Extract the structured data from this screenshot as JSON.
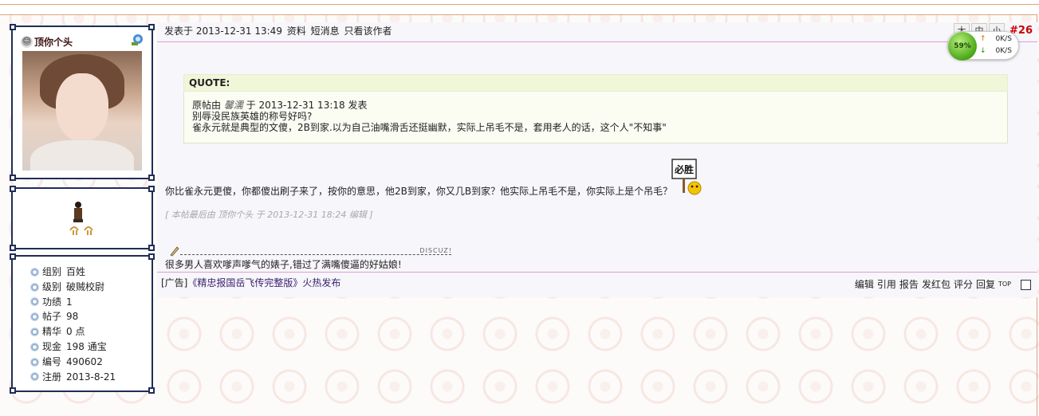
{
  "user": {
    "name": "顶你个头",
    "info": [
      {
        "label": "组别",
        "value": "百姓"
      },
      {
        "label": "级别",
        "value": "破贼校尉"
      },
      {
        "label": "功绩",
        "value": "1"
      },
      {
        "label": "帖子",
        "value": "98"
      },
      {
        "label": "精华",
        "value": "0 点"
      },
      {
        "label": "现金",
        "value": "198 通宝"
      },
      {
        "label": "编号",
        "value": "490602"
      },
      {
        "label": "注册",
        "value": "2013-8-21"
      }
    ]
  },
  "post": {
    "header": {
      "posted_at": "发表于 2013-12-31 13:49",
      "profile": "资料",
      "message": "短消息",
      "only_author": "只看该作者"
    },
    "tools": [
      "大",
      "中",
      "小"
    ],
    "floor": "#26",
    "quote": {
      "title": "QUOTE:",
      "prefix": "原帖由",
      "author": "馨濡",
      "time": "于 2013-12-31 13:18 发表",
      "line1": "别辱没民族英雄的称号好吗?",
      "line2": "雀永元就是典型的文傻，2B到家.以为自己油嘴滑舌还挺幽默，实际上吊毛不是，套用老人的话，这个人\"不知事\""
    },
    "sign_text": "必胜",
    "body": "你比雀永元更傻，你都傻出刷子来了，按你的意思，他2B到家，你又几B到家？他实际上吊毛不是，你实际上是个吊毛？",
    "edit_note": "[ 本帖最后由 顶你个头 于 2013-12-31 18:24 编辑 ]",
    "sig_tag": "DISCUZ!",
    "signature": "很多男人喜欢嗲声嗲气的婊子,错过了满嘴傻逼的好姑娘!",
    "ad_prefix": "[广告]",
    "ad_link": "《精忠报国岳飞传完整版》火热发布",
    "actions": [
      "编辑",
      "引用",
      "报告",
      "发红包",
      "评分",
      "回复"
    ],
    "top": "TOP"
  },
  "speed": {
    "percent": "59%",
    "up": "0K/S",
    "down": "0K/S"
  }
}
